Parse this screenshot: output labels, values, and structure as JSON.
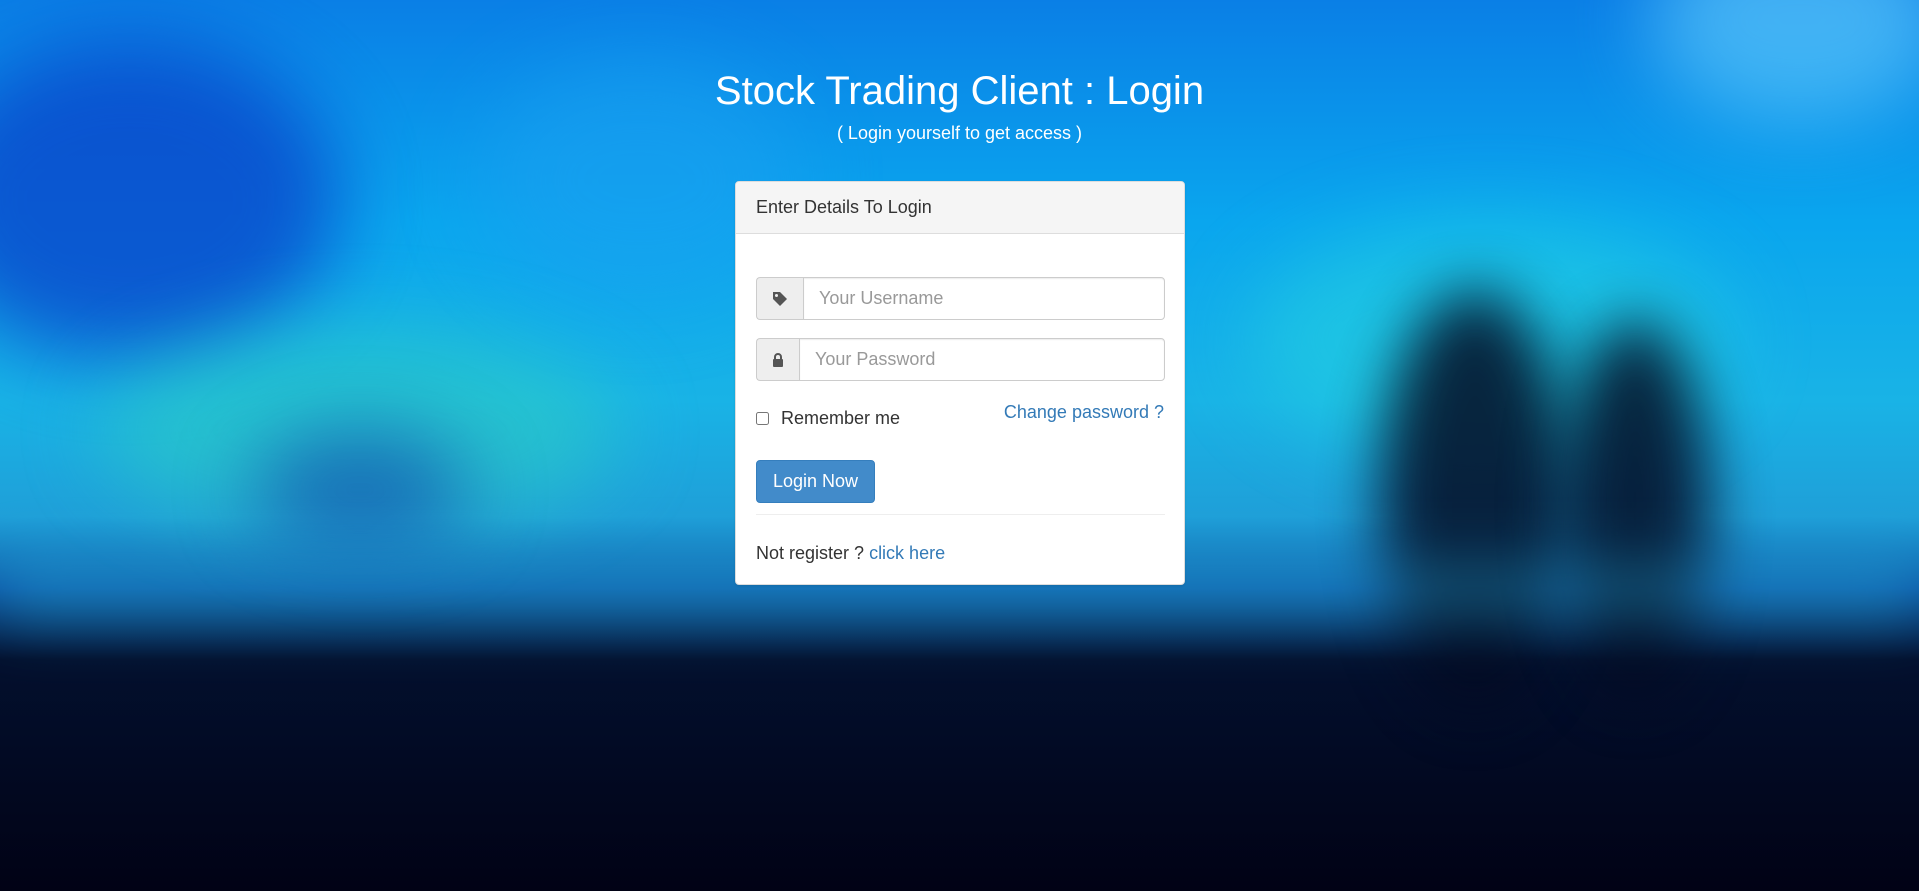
{
  "page": {
    "title": "Stock Trading Client : Login",
    "subtitle": "( Login yourself to get access )"
  },
  "panel": {
    "heading": "Enter Details To Login"
  },
  "form": {
    "username": {
      "icon": "tag-icon",
      "placeholder": "Your Username",
      "value": ""
    },
    "password": {
      "icon": "lock-icon",
      "placeholder": "Your Password",
      "value": ""
    },
    "remember_label": "Remember me",
    "remember_checked": false,
    "change_password_label": "Change password ?",
    "login_button_label": "Login Now"
  },
  "footer": {
    "register_text": "Not register ?",
    "register_link": "click here"
  },
  "colors": {
    "primary": "#428bca",
    "link": "#337ab7",
    "panel_heading_bg": "#f5f5f5"
  }
}
